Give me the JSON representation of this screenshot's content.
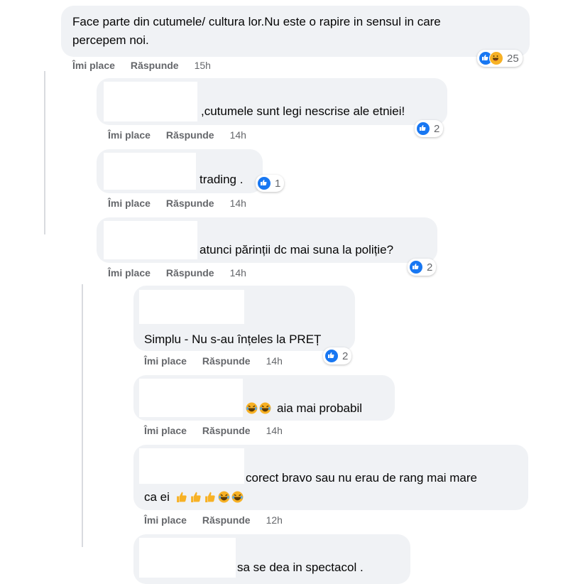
{
  "actions": {
    "like": "Îmi place",
    "reply": "Răspunde"
  },
  "comments": [
    {
      "text": "Face parte din cutumele/ cultura lor.Nu este o rapire in sensul in care",
      "text2": "percepem noi.",
      "time": "15h",
      "reactions": "25"
    },
    {
      "text": ",cutumele sunt legi nescrise ale etniei!",
      "time": "14h",
      "reactions": "2"
    },
    {
      "text": "trading .",
      "time": "14h",
      "reactions": "1"
    },
    {
      "text": "atunci părinții dc mai suna la poliție?",
      "time": "14h",
      "reactions": "2"
    },
    {
      "text": "Simplu - Nu s-au înțeles la PREȚ",
      "time": "14h",
      "reactions": "2"
    },
    {
      "text": "aia mai probabil",
      "time": "14h"
    },
    {
      "text": "corect bravo sau nu erau de rang mai mare",
      "text2": "ca ei",
      "time": "12h"
    },
    {
      "text": "sa se dea in spectacol ."
    }
  ],
  "icons": {
    "like": "like-icon",
    "haha": "haha-icon",
    "laugh_emoji": "laughing-emoji",
    "thumb_emoji": "thumbs-up-emoji"
  },
  "colors": {
    "bubble": "#f0f2f5",
    "like": "#1877f2",
    "haha": "#f7b125",
    "meta": "#65676b"
  }
}
